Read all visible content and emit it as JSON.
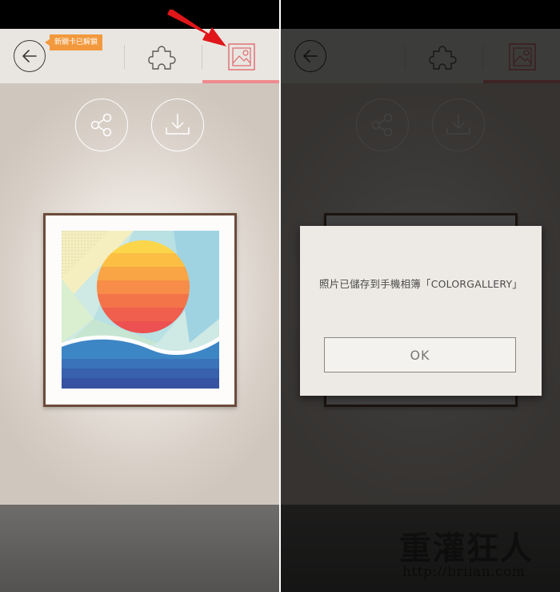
{
  "badge": {
    "label": "新關卡已解鎖"
  },
  "dialog": {
    "message": "照片已儲存到手機相簿「COLORGALLERY」",
    "ok_label": "OK"
  },
  "watermark": {
    "text": "重灌狂人",
    "url": "http://briian.com"
  },
  "icons": [
    "back-arrow-icon",
    "puzzle-icon",
    "gallery-image-icon",
    "share-icon",
    "download-icon",
    "red-arrow-pointer"
  ],
  "colors": {
    "accent": "#f08a8e",
    "badge": "#f2993d",
    "topbar": "#e9e6e1",
    "frame_border": "#6a4b3a",
    "dialog_bg": "#edeae5"
  }
}
